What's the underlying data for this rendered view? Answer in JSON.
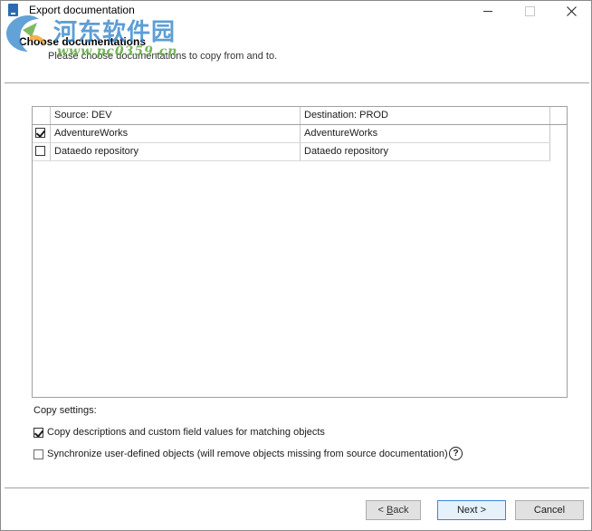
{
  "window": {
    "title": "Export documentation"
  },
  "watermark": {
    "text_cn": "河东软件园",
    "url": "www.pc0359.cn"
  },
  "header": {
    "title": "Choose documentations",
    "subtitle": "Please choose documentations to copy from and to."
  },
  "grid": {
    "columns": [
      "Source: DEV",
      "Destination: PROD"
    ],
    "rows": [
      {
        "checked": true,
        "source": "AdventureWorks",
        "destination": "AdventureWorks"
      },
      {
        "checked": false,
        "source": "Dataedo repository",
        "destination": "Dataedo repository"
      }
    ]
  },
  "settings": {
    "label": "Copy settings:",
    "options": [
      {
        "checked": true,
        "label": "Copy descriptions and custom field values for matching objects"
      },
      {
        "checked": false,
        "label": "Synchronize user-defined objects (will remove objects missing from source documentation)"
      }
    ],
    "help_icon_glyph": "?"
  },
  "footer": {
    "back_prefix": "< ",
    "back_mnemonic": "B",
    "back_rest": "ack",
    "next_label": "Next >",
    "cancel_label": "Cancel"
  },
  "colors": {
    "accent_border": "#3c86d6",
    "watermark_blue": "#2f83c9",
    "watermark_green": "#5caa3c"
  }
}
